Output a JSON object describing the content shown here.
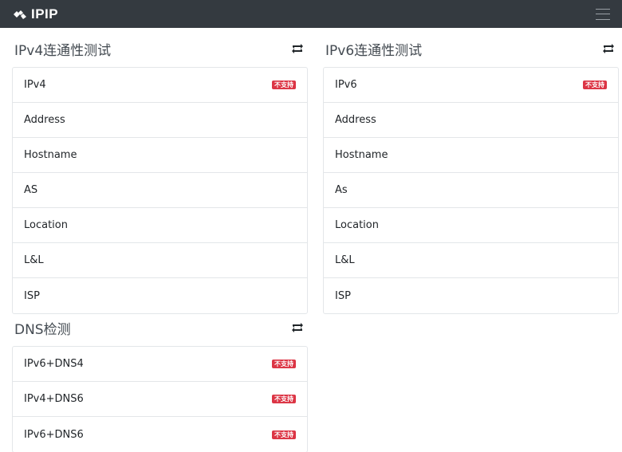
{
  "brand": {
    "name": "IPIP"
  },
  "ipv4": {
    "title": "IPv4连通性测试",
    "rows": [
      {
        "label": "IPv4",
        "badge": "不支持"
      },
      {
        "label": "Address",
        "badge": ""
      },
      {
        "label": "Hostname",
        "badge": ""
      },
      {
        "label": "AS",
        "badge": ""
      },
      {
        "label": "Location",
        "badge": ""
      },
      {
        "label": "L&L",
        "badge": ""
      },
      {
        "label": "ISP",
        "badge": ""
      }
    ]
  },
  "ipv6": {
    "title": "IPv6连通性测试",
    "rows": [
      {
        "label": "IPv6",
        "badge": "不支持"
      },
      {
        "label": "Address",
        "badge": ""
      },
      {
        "label": "Hostname",
        "badge": ""
      },
      {
        "label": "As",
        "badge": ""
      },
      {
        "label": "Location",
        "badge": ""
      },
      {
        "label": "L&L",
        "badge": ""
      },
      {
        "label": "ISP",
        "badge": ""
      }
    ]
  },
  "dns": {
    "title": "DNS检测",
    "rows": [
      {
        "label": "IPv6+DNS4",
        "badge": "不支持"
      },
      {
        "label": "IPv4+DNS6",
        "badge": "不支持"
      },
      {
        "label": "IPv6+DNS6",
        "badge": "不支持"
      }
    ]
  },
  "icons": {
    "refresh": "refresh-icon",
    "menu": "hamburger-menu-icon",
    "logo": "ipip-logo-icon"
  },
  "colors": {
    "navbar": "#343a40",
    "badge": "#dc3545",
    "border": "#e3e6e9"
  }
}
